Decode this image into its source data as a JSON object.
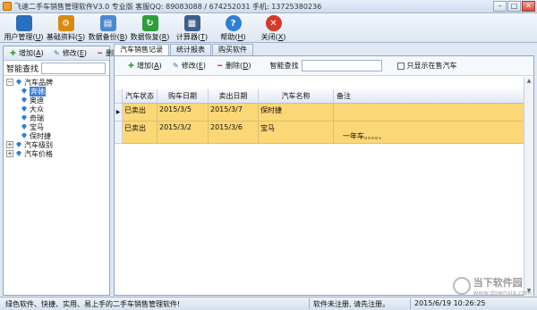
{
  "window": {
    "title": "飞速二手车销售管理软件V3.0 专业版  客服QQ: 89083088 / 674252031  手机: 13725380236",
    "buttons": [
      "minimize",
      "maximize",
      "close"
    ]
  },
  "toolbar": {
    "items": [
      {
        "label": "用户管理",
        "key": "U",
        "icon": "user-icon",
        "color": "#2f6db5"
      },
      {
        "label": "基础资料",
        "key": "S",
        "icon": "gear-icon",
        "color": "#d98a10"
      },
      {
        "label": "数据备份",
        "key": "B",
        "icon": "backup-icon",
        "color": "#4a89d0"
      },
      {
        "label": "数据恢复",
        "key": "R",
        "icon": "restore-icon",
        "color": "#2e9d3a"
      },
      {
        "label": "计算器",
        "key": "T",
        "icon": "calculator-icon",
        "color": "#3a5f8c"
      },
      {
        "label": "帮助",
        "key": "H",
        "icon": "help-icon",
        "color": "#2f7fd6"
      },
      {
        "label": "关闭",
        "key": "X",
        "icon": "close-icon",
        "color": "#d53a2a"
      }
    ]
  },
  "left": {
    "add": "增加",
    "add_key": "A",
    "edit": "修改",
    "edit_key": "E",
    "delete": "删除",
    "delete_key": "D",
    "search_label": "智能查找",
    "search_value": "",
    "tree": {
      "root": "汽车品牌",
      "children": [
        "奔驰",
        "奥迪",
        "大众",
        "奇瑞",
        "宝马",
        "保时捷"
      ],
      "selected": "奔驰",
      "others": [
        "汽车级别",
        "汽车价格"
      ]
    }
  },
  "right": {
    "tabs": [
      "汽车销售记录",
      "统计报表",
      "购买软件"
    ],
    "active_tab": "汽车销售记录",
    "add": "增加",
    "add_key": "A",
    "edit": "修改",
    "edit_key": "E",
    "delete": "删除",
    "delete_key": "D",
    "search_label": "智能查找",
    "search_value": "",
    "only_selling": "只显示在售汽车",
    "columns": [
      "汽车状态",
      "购车日期",
      "卖出日期",
      "汽车名称",
      "备注"
    ],
    "rows": [
      [
        "已卖出",
        "2015/3/5",
        "2015/3/7",
        "保时捷",
        ""
      ],
      [
        "已卖出",
        "2015/3/2",
        "2015/3/6",
        "宝马",
        "一年车。。。。、"
      ]
    ]
  },
  "status": {
    "slogan": "绿色软件、快捷、实用、易上手的二手车销售管理软件!",
    "reg": "软件未注册, 请先注册。",
    "datetime": "2015/6/19 10:26:25"
  },
  "watermark": {
    "text": "当下软件园",
    "sub": "www.downxia.com"
  },
  "colors": {
    "row_highlight": "#fbd776",
    "selection": "#3c7fd6",
    "frame": "#8fa6c5"
  }
}
